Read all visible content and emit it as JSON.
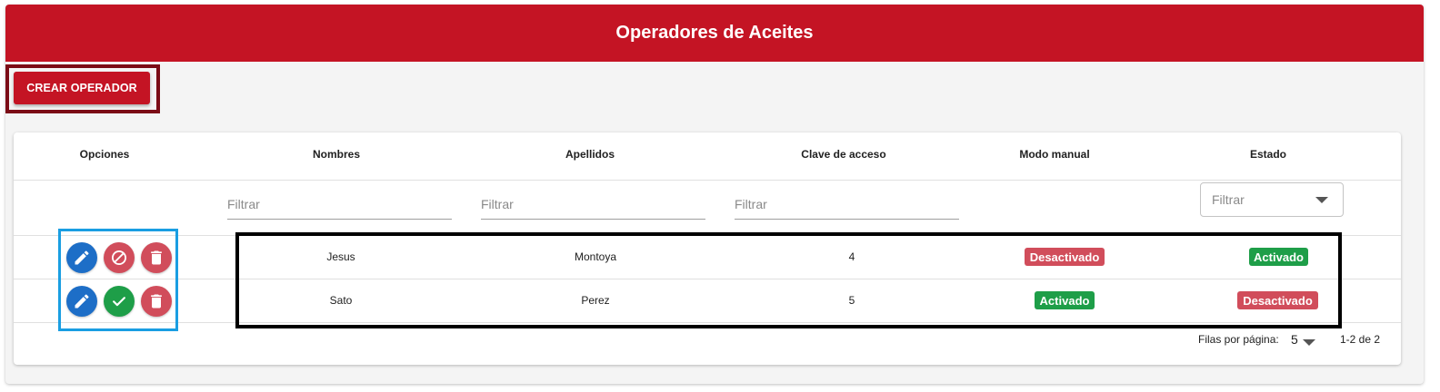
{
  "app": {
    "title": "Operadores de Aceites"
  },
  "toolbar": {
    "create_label": "CREAR OPERADOR"
  },
  "table": {
    "columns": [
      "Opciones",
      "Nombres",
      "Apellidos",
      "Clave de acceso",
      "Modo manual",
      "Estado"
    ],
    "filters": {
      "placeholder": "Filtrar",
      "estado_select": "Filtrar"
    },
    "rows": [
      {
        "nombres": "Jesus",
        "apellidos": "Montoya",
        "clave": "4",
        "modo_manual": "Desactivado",
        "estado": "Activado",
        "toggle_icon": "block-icon"
      },
      {
        "nombres": "Sato",
        "apellidos": "Perez",
        "clave": "5",
        "modo_manual": "Activado",
        "estado": "Desactivado",
        "toggle_icon": "check-icon"
      }
    ]
  },
  "pagination": {
    "rows_per_page_label": "Filas por página:",
    "rows_per_page": "5",
    "range": "1-2 de 2"
  },
  "colors": {
    "header": "#c41424",
    "activado": "#1e9e48",
    "desactivado": "#d14d5b",
    "edit": "#1d6ec7",
    "delete": "#d14d5b",
    "highlight_create": "#7b0c16",
    "highlight_options": "#1a9ee2",
    "highlight_rows": "#000000"
  }
}
